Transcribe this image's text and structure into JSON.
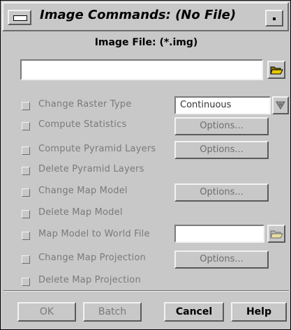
{
  "window": {
    "title": "Image Commands: (No File)"
  },
  "file_section": {
    "label": "Image File: (*.img)",
    "input_value": ""
  },
  "rows": [
    {
      "label": "Change Raster Type",
      "enabled": false
    },
    {
      "label": "Compute Statistics",
      "enabled": false
    },
    {
      "label": "Compute Pyramid Layers",
      "enabled": false
    },
    {
      "label": "Delete Pyramid Layers",
      "enabled": false
    },
    {
      "label": "Change Map Model",
      "enabled": false
    },
    {
      "label": "Delete Map Model",
      "enabled": false
    },
    {
      "label": "Map Model to World File",
      "enabled": false
    },
    {
      "label": "Change Map Projection",
      "enabled": false
    },
    {
      "label": "Delete Map Projection",
      "enabled": false
    }
  ],
  "raster_type": {
    "selected": "Continuous"
  },
  "options_label": "Options...",
  "world_file": {
    "value": ""
  },
  "buttons": {
    "ok": "OK",
    "batch": "Batch",
    "cancel": "Cancel",
    "help": "Help"
  },
  "icons": {
    "folder": "folder-open-icon",
    "dropdown": "triangle-down-icon",
    "window_menu": "window-menu-icon",
    "minimize": "minimize-icon"
  },
  "colors": {
    "background": "#c8c8c8",
    "disabled_text": "#7a7a7a",
    "folder": "#d8c000"
  }
}
